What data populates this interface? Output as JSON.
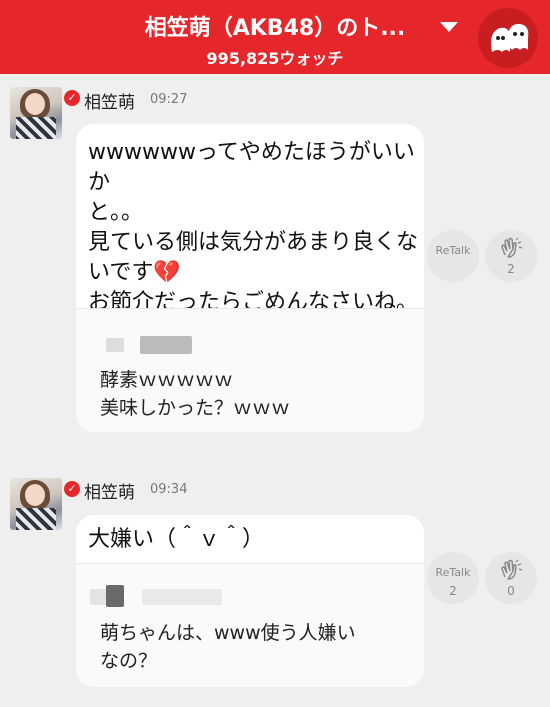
{
  "header": {
    "title": "相笠萌（AKB48）のト...",
    "watch_count": "995,825ウォッチ"
  },
  "posts": [
    {
      "author": "相笠萌",
      "time": "09:27",
      "message": [
        "wwwwwwってやめたほうがいいか",
        "と。。",
        "見ている側は気分があまり良くな",
        "いです💔",
        "お節介だったらごめんなさいね。"
      ],
      "quote": [
        "酵素ｗｗｗｗｗ",
        "美味しかった？ｗｗｗ"
      ],
      "retalk_label": "ReTalk",
      "retalk_count": "",
      "clap_count": "2"
    },
    {
      "author": "相笠萌",
      "time": "09:34",
      "message": [
        "大嫌い（＾ｖ＾）"
      ],
      "quote": [
        "萌ちゃんは、www使う人嫌い",
        "なの？"
      ],
      "retalk_label": "ReTalk",
      "retalk_count": "2",
      "clap_count": "0"
    }
  ],
  "icons": {
    "verified": "check-badge-icon",
    "dropdown": "caret-down-icon",
    "mascot": "ghost-mascot-icon",
    "clap": "clapping-hands-icon"
  },
  "colors": {
    "header_bg": "#e5262b",
    "badge": "#e5262b",
    "background": "#efefef"
  }
}
